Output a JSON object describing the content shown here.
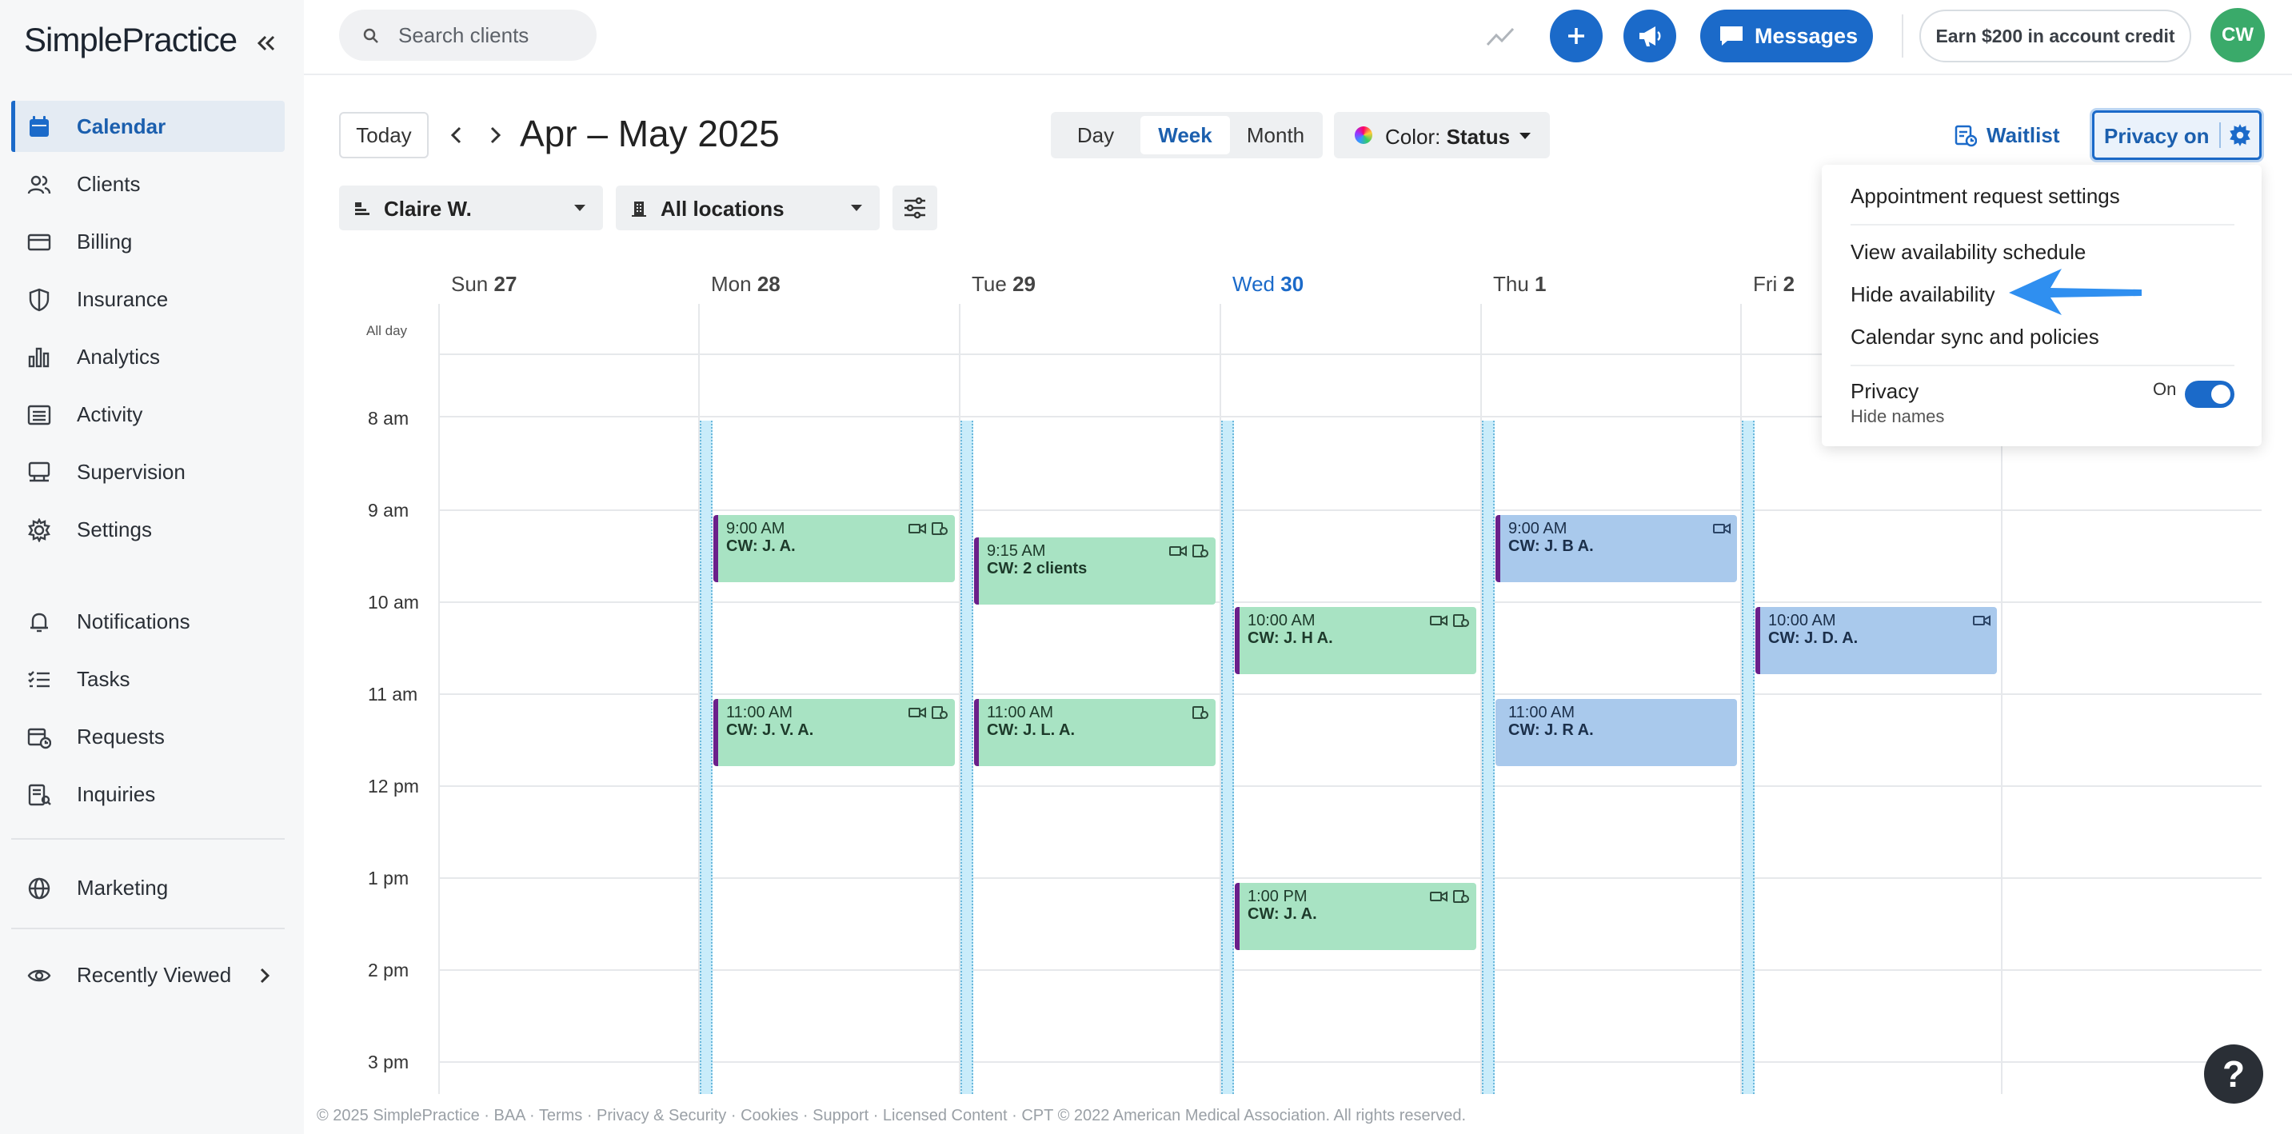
{
  "app": {
    "logo": "SimplePractice"
  },
  "sidebar": {
    "items": [
      {
        "label": "Calendar",
        "icon": "calendar-icon"
      },
      {
        "label": "Clients",
        "icon": "users-icon"
      },
      {
        "label": "Billing",
        "icon": "credit-card-icon"
      },
      {
        "label": "Insurance",
        "icon": "shield-icon"
      },
      {
        "label": "Analytics",
        "icon": "bar-chart-icon"
      },
      {
        "label": "Activity",
        "icon": "list-icon"
      },
      {
        "label": "Supervision",
        "icon": "supervision-icon"
      },
      {
        "label": "Settings",
        "icon": "gear-icon"
      }
    ],
    "items2": [
      {
        "label": "Notifications",
        "icon": "bell-icon"
      },
      {
        "label": "Tasks",
        "icon": "tasks-icon"
      },
      {
        "label": "Requests",
        "icon": "calendar-request-icon"
      },
      {
        "label": "Inquiries",
        "icon": "inquiries-icon"
      }
    ],
    "marketing": "Marketing",
    "recently_viewed": "Recently Viewed"
  },
  "topbar": {
    "search_placeholder": "Search clients",
    "messages_label": "Messages",
    "earn_label": "Earn $200 in account credit",
    "avatar_initials": "CW"
  },
  "toolbar": {
    "today_label": "Today",
    "date_range": "Apr – May 2025",
    "views": [
      {
        "label": "Day",
        "active": false
      },
      {
        "label": "Week",
        "active": true
      },
      {
        "label": "Month",
        "active": false
      }
    ],
    "color_label": "Color:",
    "color_value": "Status",
    "waitlist_label": "Waitlist",
    "privacy_label": "Privacy on"
  },
  "filters": {
    "clinician": "Claire W.",
    "location": "All locations"
  },
  "calendar": {
    "all_day_label": "All day",
    "days": [
      {
        "name": "Sun",
        "num": "27",
        "today": false
      },
      {
        "name": "Mon",
        "num": "28",
        "today": false
      },
      {
        "name": "Tue",
        "num": "29",
        "today": false
      },
      {
        "name": "Wed",
        "num": "30",
        "today": true
      },
      {
        "name": "Thu",
        "num": "1",
        "today": false
      },
      {
        "name": "Fri",
        "num": "2",
        "today": false
      }
    ],
    "times": [
      "8 am",
      "9 am",
      "10 am",
      "11 am",
      "12 pm",
      "1 pm",
      "2 pm",
      "3 pm"
    ],
    "appointments": [
      {
        "day": 1,
        "time": "9:00 AM",
        "client": "CW: J. A.",
        "color": "green",
        "icons": [
          "video-icon",
          "calendar-check-icon"
        ]
      },
      {
        "day": 1,
        "time": "11:00 AM",
        "client": "CW: J. V. A.",
        "color": "green",
        "icons": [
          "video-icon",
          "calendar-check-icon"
        ]
      },
      {
        "day": 2,
        "time": "9:15 AM",
        "client": "CW: 2 clients",
        "color": "green",
        "icons": [
          "video-icon",
          "calendar-check-icon"
        ]
      },
      {
        "day": 2,
        "time": "11:00 AM",
        "client": "CW: J. L. A.",
        "color": "green",
        "icons": [
          "calendar-check-icon"
        ]
      },
      {
        "day": 3,
        "time": "10:00 AM",
        "client": "CW: J. H A.",
        "color": "green",
        "icons": [
          "video-icon",
          "calendar-check-icon"
        ]
      },
      {
        "day": 3,
        "time": "1:00 PM",
        "client": "CW: J. A.",
        "color": "green",
        "icons": [
          "video-icon",
          "calendar-check-icon"
        ]
      },
      {
        "day": 4,
        "time": "9:00 AM",
        "client": "CW: J. B A.",
        "color": "blue",
        "icons": [
          "video-icon"
        ]
      },
      {
        "day": 4,
        "time": "11:00 AM",
        "client": "CW: J. R A.",
        "color": "blue",
        "icons": []
      },
      {
        "day": 5,
        "time": "10:00 AM",
        "client": "CW: J. D. A.",
        "color": "blue",
        "icons": [
          "video-icon"
        ]
      }
    ]
  },
  "dropdown": {
    "items": [
      "Appointment request settings",
      "View availability schedule",
      "Hide availability",
      "Calendar sync and policies"
    ],
    "privacy_title": "Privacy",
    "privacy_sub": "Hide names",
    "toggle_label": "On",
    "toggle_on": true
  },
  "footer": {
    "text": "© 2025 SimplePractice · BAA · Terms · Privacy & Security · Cookies · Support · Licensed Content · CPT © 2022 American Medical Association. All rights reserved."
  },
  "help_label": "?",
  "colors": {
    "primary": "#1b6ac9",
    "appt_green": "#a8e3c3",
    "appt_blue": "#a9c9ec",
    "appt_border": "#6b1f8a",
    "availability": "#c9ecfa",
    "avatar": "#3aaa6a"
  }
}
